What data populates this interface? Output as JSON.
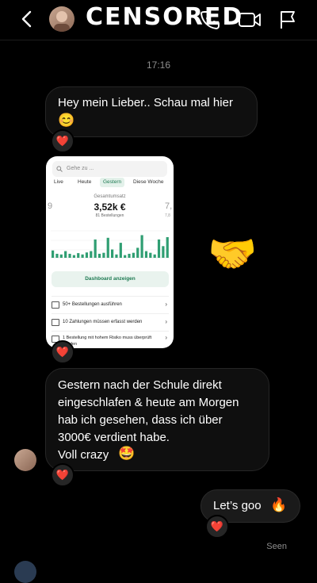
{
  "header": {
    "title": "CENSORED",
    "icons": [
      "back-arrow",
      "phone",
      "video-camera",
      "flag"
    ]
  },
  "timestamp": "17:16",
  "messages": [
    {
      "text_line1": "Hey mein Lieber.. Schau mal hier",
      "emoji": "😊",
      "reaction": "❤️"
    },
    {
      "type": "image",
      "reaction": "❤️"
    },
    {
      "type": "emoji",
      "emoji": "🤝"
    },
    {
      "lines": [
        "Gestern nach der Schule direkt",
        "eingeschlafen & heute am Morgen",
        "hab ich gesehen, dass ich über",
        "3000€ verdient habe.",
        "Voll crazy"
      ],
      "emoji": "🤩",
      "reaction": "❤️"
    },
    {
      "text": "Let’s goo",
      "emoji": "🔥",
      "reaction": "❤️",
      "outgoing": true
    }
  ],
  "status": "Seen",
  "screenshot": {
    "search_placeholder": "Gehe zu ...",
    "tabs": [
      "Live",
      "Heute",
      "Gestern",
      "Diese Woche"
    ],
    "active_tab": "Gestern",
    "kpi_label": "Gesamtumsatz",
    "kpi_value": "3,52k €",
    "kpi_sub": "81 Bestellungen",
    "left_partial": "9",
    "right_partial_1": "7,",
    "right_partial_2": "7,8",
    "button": "Dashboard anzeigen",
    "rows": [
      "50+ Bestellungen ausführen",
      "10 Zahlungen müssen erfasst werden",
      "1 Bestellung mit hohem Risiko muss überprüft werden"
    ],
    "chart_bars": [
      0.22,
      0.12,
      0.1,
      0.2,
      0.12,
      0.08,
      0.14,
      0.1,
      0.16,
      0.2,
      0.55,
      0.12,
      0.15,
      0.6,
      0.25,
      0.1,
      0.45,
      0.08,
      0.12,
      0.15,
      0.3,
      0.68,
      0.2,
      0.15,
      0.1,
      0.55,
      0.35,
      0.62
    ],
    "colors": {
      "accent": "#1e7a52",
      "bar": "#2f9e72"
    }
  }
}
